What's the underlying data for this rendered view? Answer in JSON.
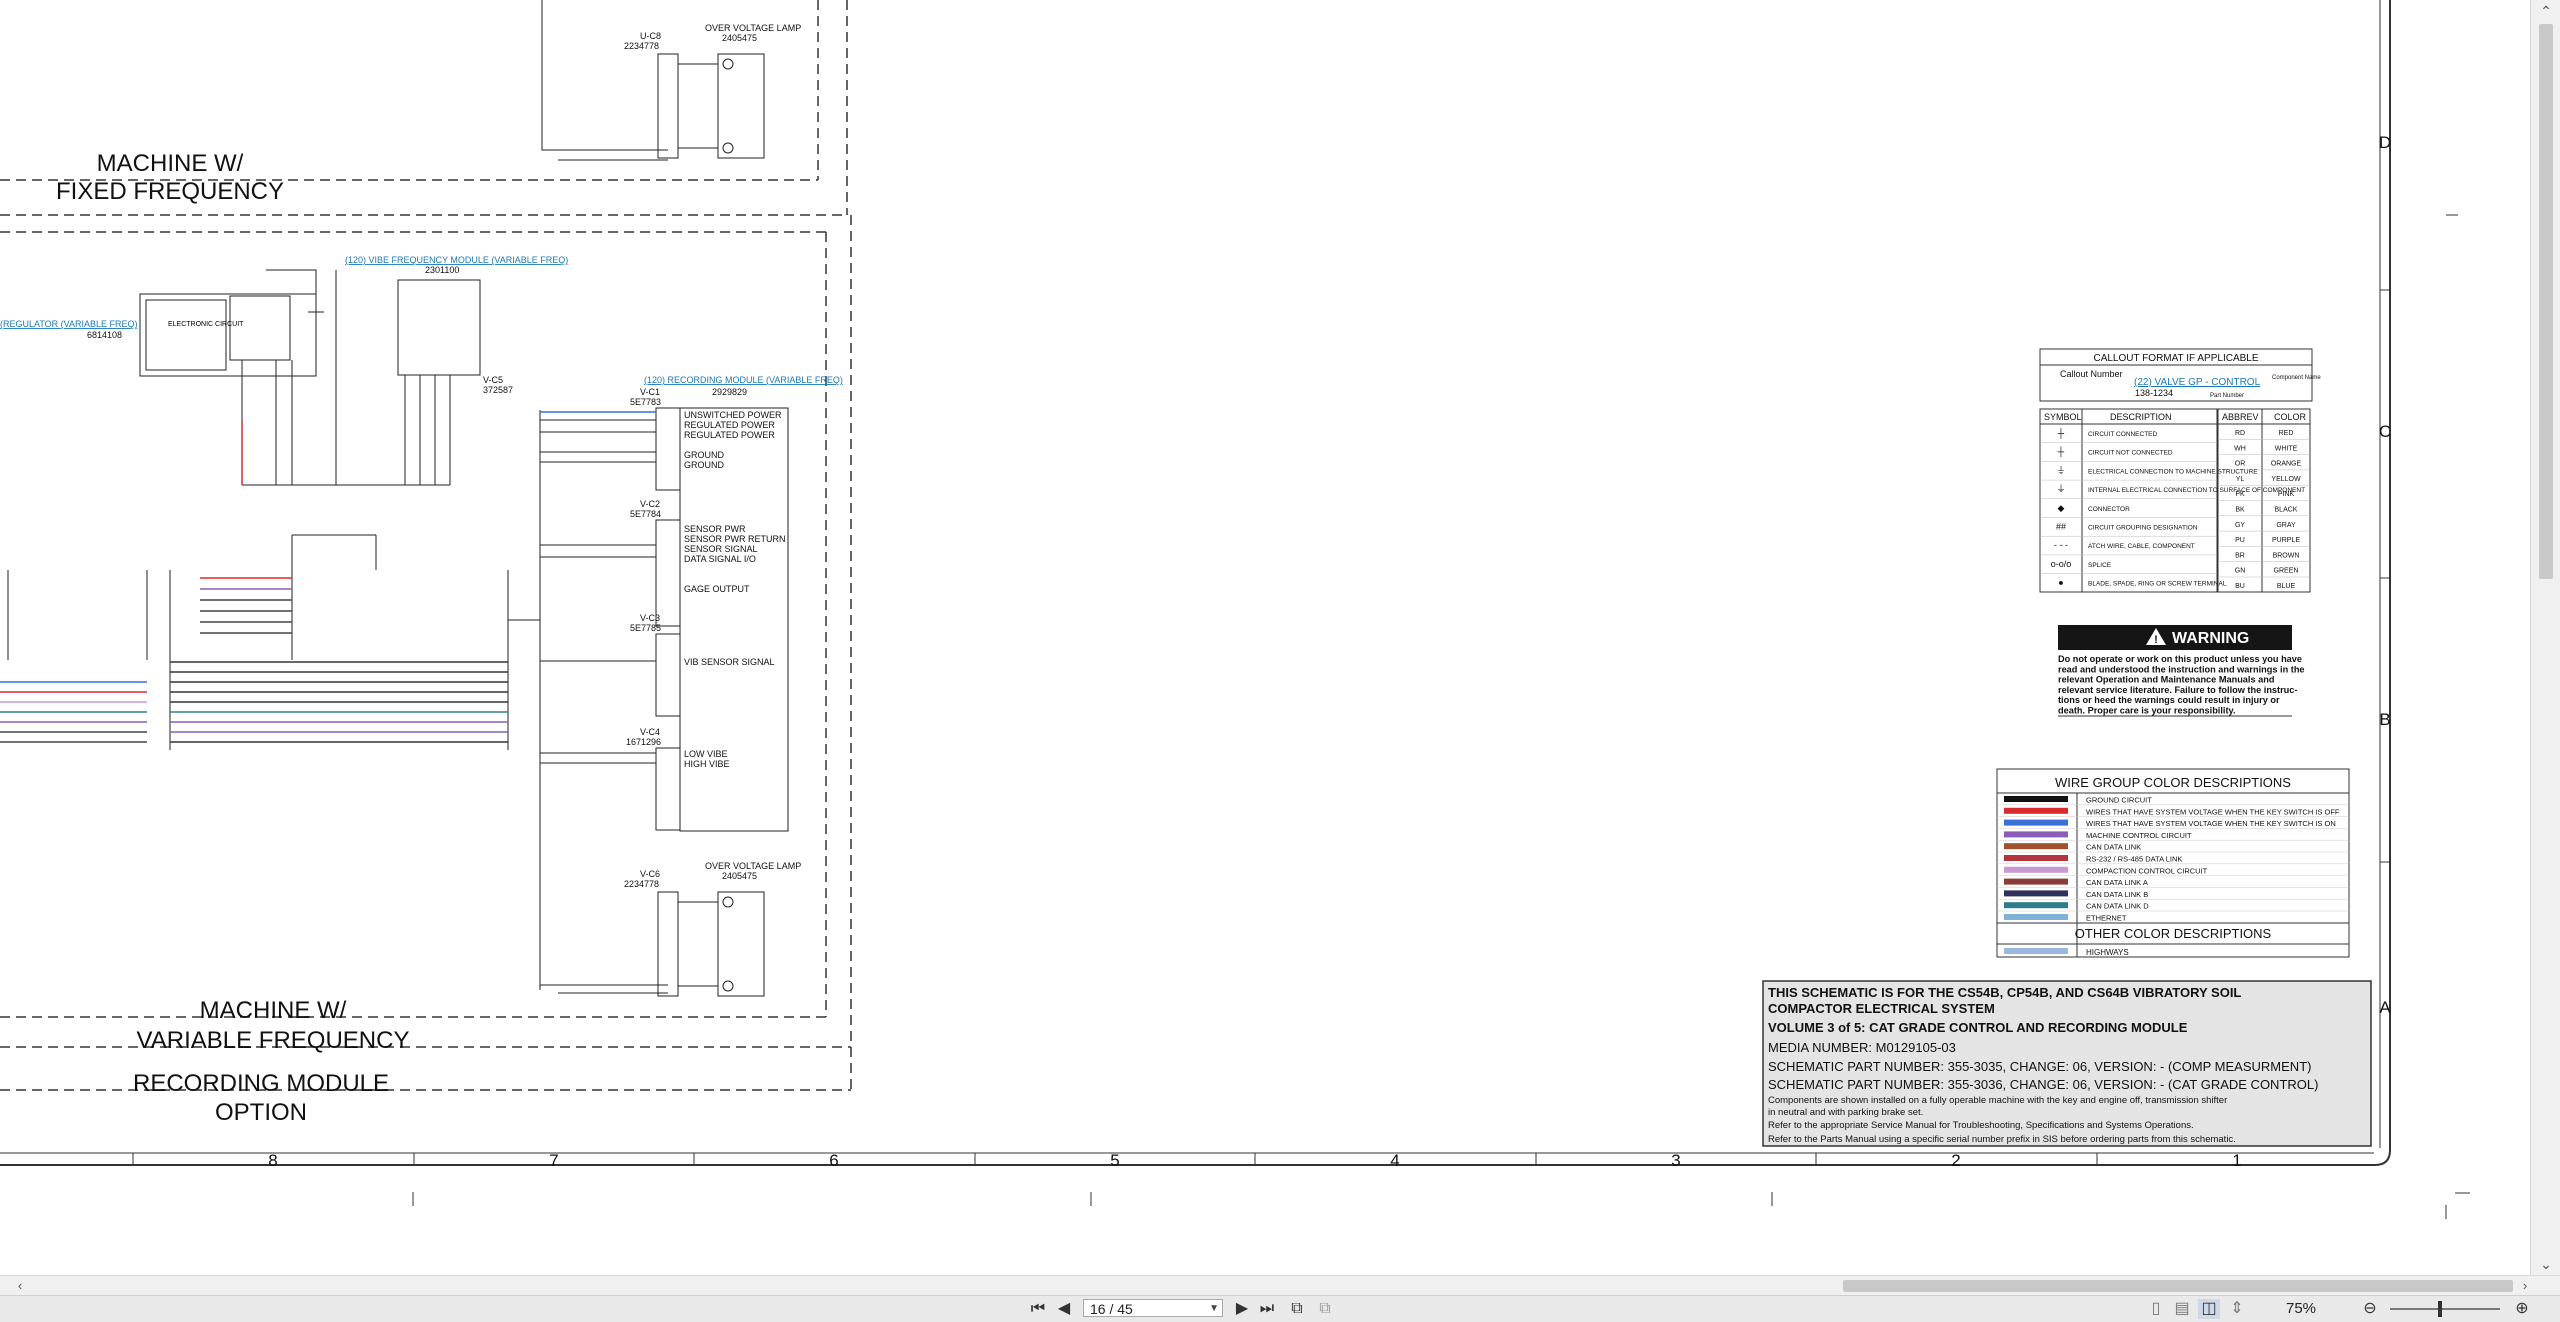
{
  "viewer": {
    "page_indicator": "16 / 45",
    "zoom": "75%"
  },
  "schematic": {
    "labels": {
      "machine_fixed_line1": "MACHINE W/",
      "machine_fixed_line2": "FIXED FREQUENCY",
      "machine_var_line1": "MACHINE W/",
      "machine_var_line2": "VARIABLE FREQUENCY",
      "recording_line1": "RECORDING MODULE",
      "recording_line2": "OPTION",
      "over_voltage_lamp": "OVER VOLTAGE LAMP",
      "over_voltage_part": "2405475",
      "u_c8": "U-C8",
      "u_c8_part": "2234778",
      "vibe_module_link": "(120) VIBE FREQUENCY MODULE (VARIABLE FREQ)",
      "vibe_module_part": "2301100",
      "regulator_link": "(REGULATOR (VARIABLE FREQ)",
      "regulator_part": "6814108",
      "electronic_circuit": "ELECTRONIC CIRCUIT",
      "v_c5": "V-C5",
      "v_c5_part": "372587",
      "recording_link": "(120) RECORDING MODULE (VARIABLE FREQ)",
      "recording_part": "2929829",
      "v_c1": "V-C1",
      "v_c1_part": "5E7783",
      "v_c2": "V-C2",
      "v_c2_part": "5E7784",
      "v_c3": "V-C3",
      "v_c3_part": "5E7785",
      "v_c4": "V-C4",
      "v_c4_part": "1671296",
      "v_c6": "V-C6",
      "v_c6_part": "2234778"
    },
    "recording_pins": {
      "c1": [
        "UNSWITCHED POWER",
        "REGULATED POWER",
        "REGULATED POWER",
        "",
        "GROUND",
        "GROUND"
      ],
      "c2": [
        "SENSOR PWR",
        "SENSOR PWR RETURN",
        "SENSOR SIGNAL",
        "DATA SIGNAL I/O",
        "",
        "GAGE OUTPUT"
      ],
      "c3": [
        "VIB SENSOR SIGNAL"
      ],
      "c4": [
        "LOW VIBE",
        "HIGH VIBE"
      ]
    },
    "zone_columns": [
      "8",
      "7",
      "6",
      "5",
      "4",
      "3",
      "2",
      "1"
    ],
    "zone_rows": [
      "D",
      "C",
      "B",
      "A"
    ]
  },
  "callout": {
    "title": "CALLOUT FORMAT IF APPLICABLE",
    "callout_number": "Callout Number",
    "example_link": "(22) VALVE GP - CONTROL",
    "example_part": "138-1234",
    "component_name": "Component Name",
    "part_number": "Part Number"
  },
  "symbol_table": {
    "header_symbol": "SYMBOL",
    "header_description": "DESCRIPTION",
    "rows": [
      {
        "symbol": "┼",
        "description": "CIRCUIT CONNECTED"
      },
      {
        "symbol": "┼",
        "description": "CIRCUIT NOT CONNECTED"
      },
      {
        "symbol": "⏚",
        "description": "ELECTRICAL CONNECTION TO MACHINE STRUCTURE"
      },
      {
        "symbol": "⏚",
        "description": "INTERNAL ELECTRICAL CONNECTION TO SURFACE OF COMPONENT"
      },
      {
        "symbol": "◆",
        "description": "CONNECTOR"
      },
      {
        "symbol": "##",
        "description": "CIRCUIT GROUPING DESIGNATION"
      },
      {
        "symbol": "- - -",
        "description": "ATCH WIRE, CABLE, COMPONENT"
      },
      {
        "symbol": "o-o/o",
        "description": "SPLICE"
      },
      {
        "symbol": "●",
        "description": "BLADE, SPADE, RING OR SCREW TERMINAL"
      }
    ]
  },
  "color_abbrev": {
    "header_abbrev": "ABBREV",
    "header_color": "COLOR",
    "rows": [
      {
        "abbrev": "RD",
        "color": "RED"
      },
      {
        "abbrev": "WH",
        "color": "WHITE"
      },
      {
        "abbrev": "OR",
        "color": "ORANGE"
      },
      {
        "abbrev": "YL",
        "color": "YELLOW"
      },
      {
        "abbrev": "PK",
        "color": "PINK"
      },
      {
        "abbrev": "BK",
        "color": "BLACK"
      },
      {
        "abbrev": "GY",
        "color": "GRAY"
      },
      {
        "abbrev": "PU",
        "color": "PURPLE"
      },
      {
        "abbrev": "BR",
        "color": "BROWN"
      },
      {
        "abbrev": "GN",
        "color": "GREEN"
      },
      {
        "abbrev": "BU",
        "color": "BLUE"
      }
    ]
  },
  "warning": {
    "title": "WARNING",
    "lines": [
      "Do not operate or work on this product unless you have",
      "read and understood the instruction and warnings in the",
      "relevant Operation and Maintenance Manuals and",
      "relevant service literature. Failure to follow the instruc-",
      "tions or heed the warnings could result in injury or",
      "death. Proper care is your responsibility."
    ]
  },
  "wire_groups": {
    "title": "WIRE GROUP COLOR DESCRIPTIONS",
    "rows": [
      {
        "label": "GROUND CIRCUIT",
        "color": "#111111"
      },
      {
        "label": "WIRES THAT HAVE SYSTEM VOLTAGE WHEN THE KEY SWITCH IS OFF",
        "color": "#d92b2b"
      },
      {
        "label": "WIRES THAT HAVE SYSTEM VOLTAGE WHEN THE KEY SWITCH IS ON",
        "color": "#3a6fd8"
      },
      {
        "label": "MACHINE CONTROL CIRCUIT",
        "color": "#8a5db8"
      },
      {
        "label": "CAN DATA LINK",
        "color": "#a0522d"
      },
      {
        "label": "RS-232 / RS-485 DATA LINK",
        "color": "#b5333f"
      },
      {
        "label": "COMPACTION CONTROL CIRCUIT",
        "color": "#c79ad6"
      },
      {
        "label": "CAN DATA LINK A",
        "color": "#8b3a3a"
      },
      {
        "label": "CAN DATA LINK B",
        "color": "#2f2f5f"
      },
      {
        "label": "CAN DATA LINK D",
        "color": "#2e7d8c"
      },
      {
        "label": "ETHERNET",
        "color": "#7fb2d6"
      }
    ],
    "other_title": "OTHER COLOR DESCRIPTIONS",
    "other_rows": [
      {
        "label": "HIGHWAYS",
        "color": "#9ab8dd"
      }
    ]
  },
  "title_block": {
    "line1": "THIS SCHEMATIC IS FOR THE CS54B, CP54B, AND CS64B VIBRATORY SOIL",
    "line2": "COMPACTOR ELECTRICAL SYSTEM",
    "line3": "VOLUME 3 of 5: CAT GRADE CONTROL AND RECORDING MODULE",
    "media": "MEDIA NUMBER: M0129105-03",
    "part1": "SCHEMATIC PART NUMBER: 355-3035, CHANGE: 06, VERSION: - (COMP MEASURMENT)",
    "part2": "SCHEMATIC PART NUMBER: 355-3036, CHANGE: 06, VERSION: - (CAT GRADE CONTROL)",
    "note1": "Components are shown installed on a fully operable machine with the key and engine off, transmission shifter",
    "note2": "in neutral and with parking brake set.",
    "note3": "Refer to the appropriate Service Manual for Troubleshooting, Specifications and Systems Operations.",
    "note4": "Refer to the Parts Manual using a specific serial number prefix in SIS before ordering parts from this schematic."
  }
}
